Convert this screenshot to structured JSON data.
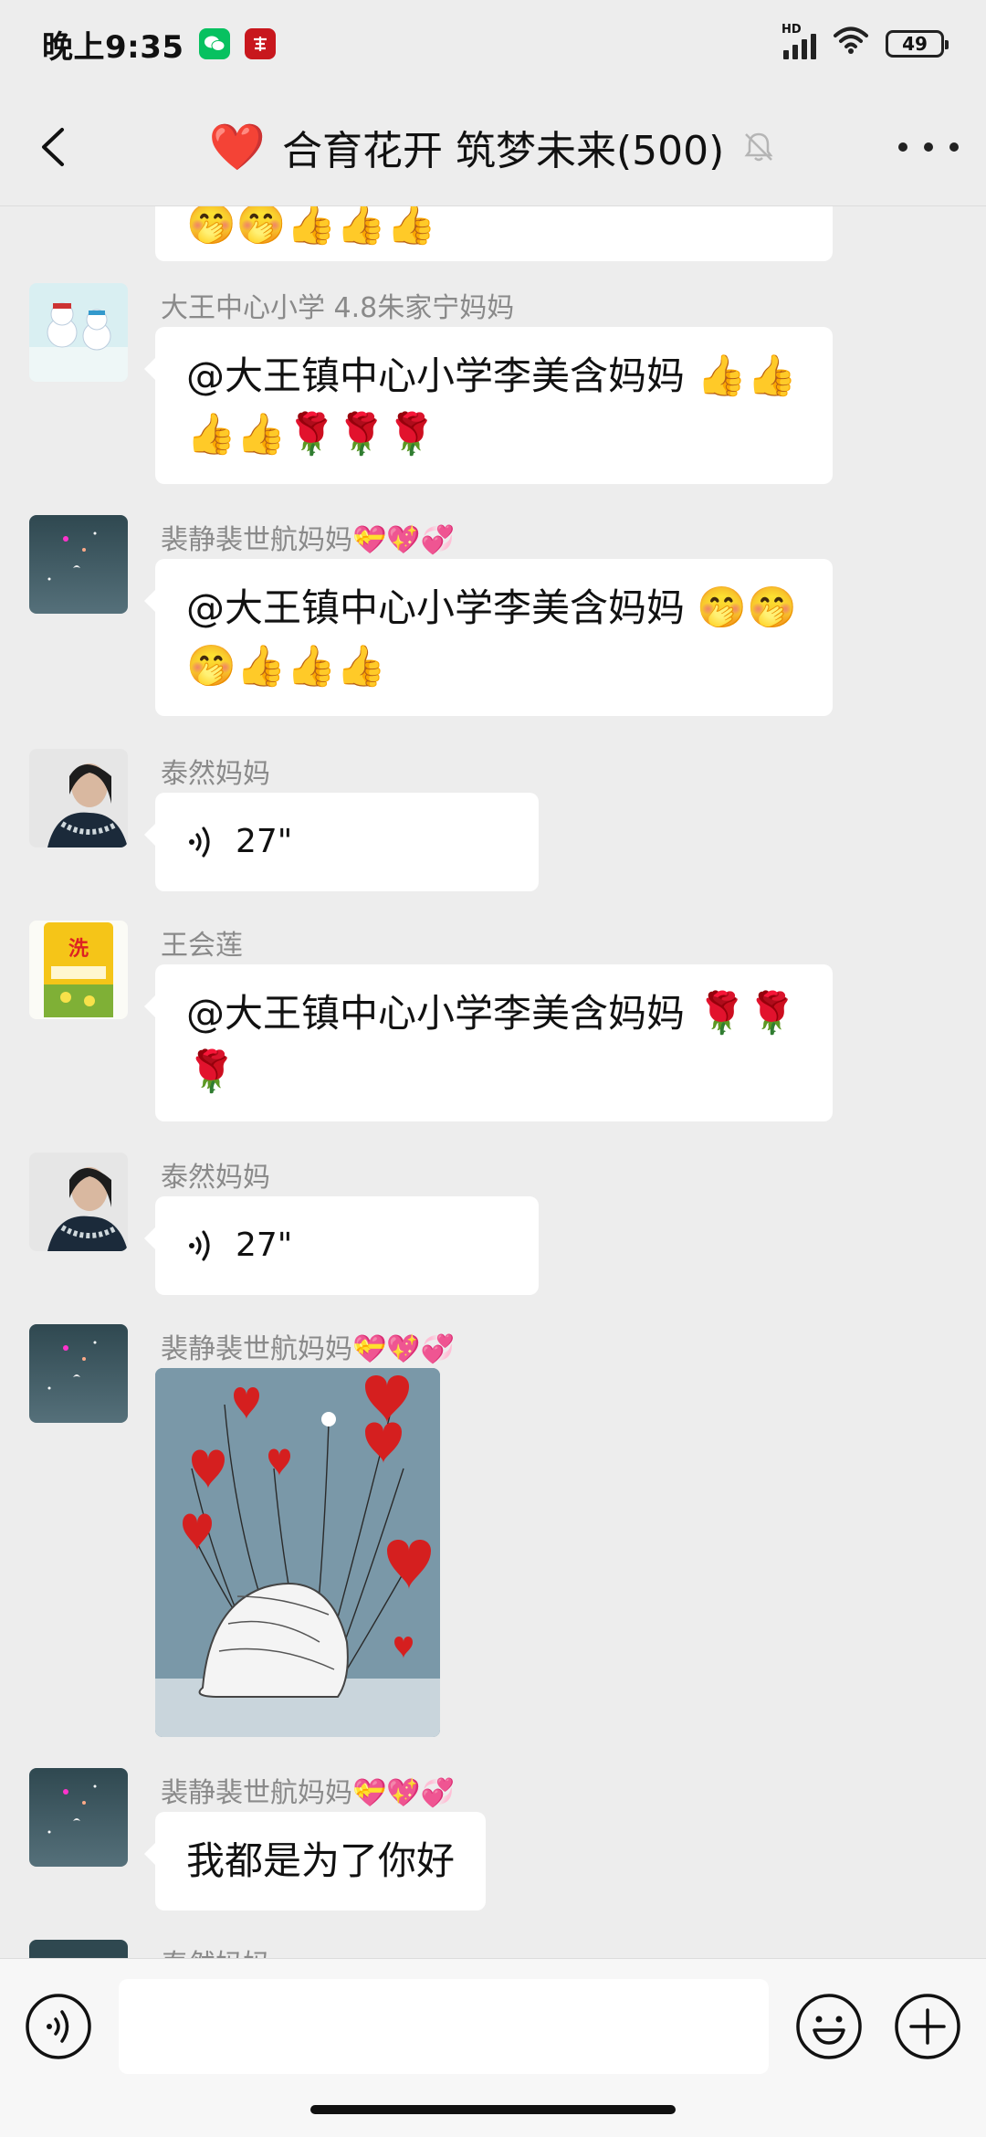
{
  "status_bar": {
    "time": "晚上9:35",
    "network": "HD",
    "battery": "49"
  },
  "header": {
    "heart": "❤️",
    "title": "合育花开 筑梦未来(500)"
  },
  "chat": {
    "partial_top_emojis": "🤭🤭👍👍👍",
    "messages": [
      {
        "type": "text",
        "sender": "大王中心小学 4.8朱家宁妈妈",
        "text": "@大王镇中心小学李美含妈妈",
        "emojis": "👍👍👍👍🌹🌹🌹"
      },
      {
        "type": "text",
        "sender": "裴静裴世航妈妈💝💖💞",
        "text": "@大王镇中心小学李美含妈妈",
        "emojis": "🤭🤭🤭👍👍👍"
      },
      {
        "type": "voice",
        "sender": "泰然妈妈",
        "duration": "27\""
      },
      {
        "type": "text",
        "sender": "王会莲",
        "text": "@大王镇中心小学李美含妈妈",
        "emojis": "🌹🌹🌹"
      },
      {
        "type": "voice",
        "sender": "泰然妈妈",
        "duration": "27\""
      },
      {
        "type": "image",
        "sender": "裴静裴世航妈妈💝💖💞"
      },
      {
        "type": "text",
        "sender": "裴静裴世航妈妈💝💖💞",
        "text": "我都是为了你好"
      },
      {
        "type": "partial",
        "sender": "泰然妈妈"
      }
    ]
  },
  "input": {
    "value": "",
    "placeholder": ""
  },
  "colors": {
    "background": "#ededed",
    "bubble": "#ffffff",
    "wechat_green": "#07c160",
    "heart": "#e11b2c"
  },
  "icons": {
    "back": "chevron-left-icon",
    "mute": "bell-off-icon",
    "more": "more-icon",
    "voice": "voice-icon",
    "emoji": "emoji-icon",
    "plus": "plus-icon"
  }
}
